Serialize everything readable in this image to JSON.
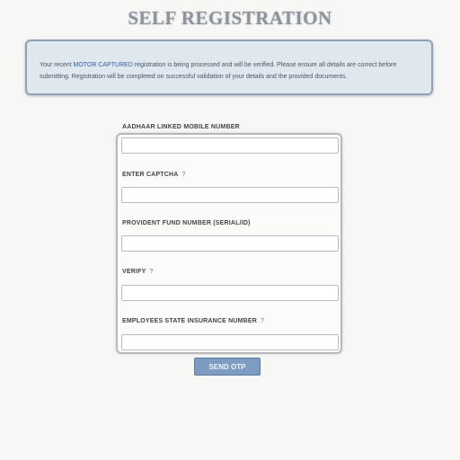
{
  "page": {
    "title": "SELF REGISTRATION"
  },
  "notice": {
    "text_before": "Your recent ",
    "highlight": "MOTOR CAPTURED",
    "text_after": " registration is being processed and will be verified. Please ensure all details are correct before submitting. Registration will be completed on successful validation of your details and the provided documents."
  },
  "form": {
    "fields": [
      {
        "label": "AADHAAR LINKED MOBILE NUMBER",
        "info": "",
        "value": "",
        "placeholder": ""
      },
      {
        "label": "ENTER CAPTCHA",
        "info": "?",
        "value": "",
        "placeholder": ""
      },
      {
        "label": "PROVIDENT FUND NUMBER (SERIAL/ID)",
        "info": "",
        "value": "",
        "placeholder": ""
      },
      {
        "label": "VERIFY",
        "info": "?",
        "value": "",
        "placeholder": ""
      },
      {
        "label": "EMPLOYEES STATE INSURANCE NUMBER",
        "info": "?",
        "value": "",
        "placeholder": ""
      }
    ],
    "submit_label": "SEND OTP"
  }
}
